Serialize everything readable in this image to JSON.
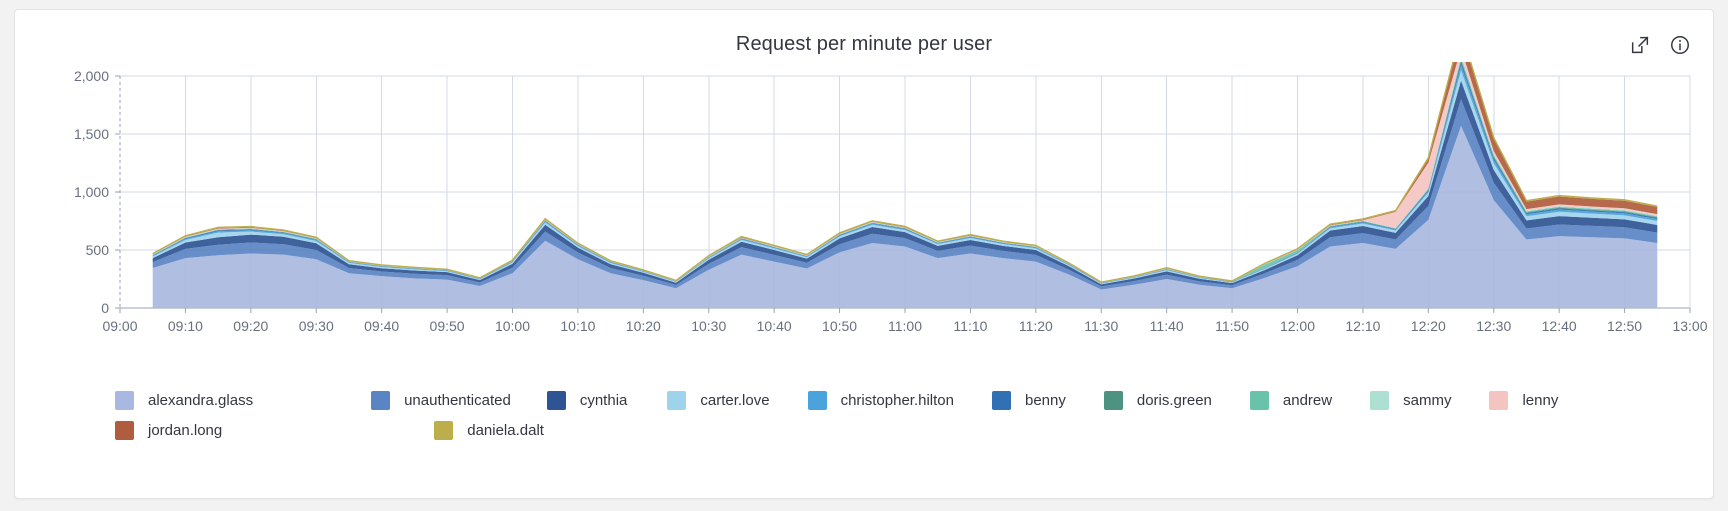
{
  "panel": {
    "title": "Request per minute per user",
    "actions": [
      {
        "name": "open-in-new-icon",
        "label": "Open in new window"
      },
      {
        "name": "info-icon",
        "label": "Panel information"
      }
    ]
  },
  "legend": [
    {
      "label": "alexandra.glass",
      "color": "#a9b8e0"
    },
    {
      "label": "unauthenticated",
      "color": "#5b84c4"
    },
    {
      "label": "cynthia",
      "color": "#2f5494"
    },
    {
      "label": "carter.love",
      "color": "#9fd3ec"
    },
    {
      "label": "christopher.hilton",
      "color": "#4aa3db"
    },
    {
      "label": "benny",
      "color": "#3070b3"
    },
    {
      "label": "doris.green",
      "color": "#4e9281"
    },
    {
      "label": "andrew",
      "color": "#69c3ab"
    },
    {
      "label": "sammy",
      "color": "#aee0d2"
    },
    {
      "label": "lenny",
      "color": "#f4c4c0"
    },
    {
      "label": "jordan.long",
      "color": "#b05c3e"
    },
    {
      "label": "daniela.dalt",
      "color": "#bdae4c"
    }
  ],
  "chart_data": {
    "type": "area",
    "stacked": true,
    "title": "Request per minute per user",
    "xlabel": "",
    "ylabel": "",
    "grid": true,
    "legend_position": "bottom",
    "ylim": [
      0,
      2000
    ],
    "yticks": [
      0,
      500,
      1000,
      1500,
      2000
    ],
    "ytick_labels": [
      "0",
      "500",
      "1,000",
      "1,500",
      "2,000"
    ],
    "xticks": [
      "09:00",
      "09:10",
      "09:20",
      "09:30",
      "09:40",
      "09:50",
      "10:00",
      "10:10",
      "10:20",
      "10:30",
      "10:40",
      "10:50",
      "11:00",
      "11:10",
      "11:20",
      "11:30",
      "11:40",
      "11:50",
      "12:00",
      "12:10",
      "12:20",
      "12:30",
      "12:40",
      "12:50",
      "13:00"
    ],
    "x": [
      "09:05",
      "09:10",
      "09:15",
      "09:20",
      "09:25",
      "09:30",
      "09:35",
      "09:40",
      "09:45",
      "09:50",
      "09:55",
      "10:00",
      "10:05",
      "10:10",
      "10:15",
      "10:20",
      "10:25",
      "10:30",
      "10:35",
      "10:40",
      "10:45",
      "10:50",
      "10:55",
      "11:00",
      "11:05",
      "11:10",
      "11:15",
      "11:20",
      "11:25",
      "11:30",
      "11:35",
      "11:40",
      "11:45",
      "11:50",
      "11:55",
      "12:00",
      "12:05",
      "12:10",
      "12:15",
      "12:20",
      "12:25",
      "12:30",
      "12:35",
      "12:40",
      "12:45",
      "12:50",
      "12:55"
    ],
    "series": [
      {
        "name": "alexandra.glass",
        "color": "#a9b8e0",
        "values": [
          345,
          430,
          455,
          470,
          460,
          420,
          300,
          275,
          255,
          245,
          190,
          300,
          580,
          420,
          300,
          240,
          170,
          330,
          460,
          400,
          340,
          480,
          560,
          530,
          430,
          470,
          430,
          400,
          290,
          160,
          200,
          250,
          200,
          170,
          260,
          360,
          530,
          560,
          510,
          760,
          1570,
          930,
          590,
          620,
          610,
          600,
          560
        ]
      },
      {
        "name": "unauthenticated",
        "color": "#5b84c4",
        "values": [
          50,
          80,
          90,
          95,
          90,
          80,
          45,
          40,
          40,
          38,
          30,
          48,
          80,
          58,
          45,
          38,
          28,
          50,
          65,
          58,
          50,
          70,
          80,
          72,
          62,
          68,
          62,
          58,
          42,
          26,
          32,
          38,
          30,
          26,
          40,
          55,
          80,
          85,
          80,
          120,
          230,
          150,
          95,
          100,
          98,
          96,
          90
        ]
      },
      {
        "name": "cynthia",
        "color": "#2f5494",
        "values": [
          35,
          55,
          65,
          68,
          64,
          58,
          32,
          28,
          28,
          26,
          20,
          34,
          58,
          42,
          32,
          26,
          20,
          36,
          46,
          42,
          36,
          50,
          58,
          52,
          44,
          48,
          44,
          42,
          30,
          18,
          22,
          28,
          22,
          18,
          28,
          40,
          58,
          62,
          58,
          85,
          160,
          110,
          70,
          72,
          70,
          68,
          66
        ]
      },
      {
        "name": "carter.love",
        "color": "#9fd3ec",
        "values": [
          14,
          22,
          40,
          26,
          22,
          20,
          12,
          10,
          10,
          9,
          7,
          12,
          20,
          14,
          11,
          9,
          7,
          12,
          16,
          14,
          12,
          17,
          20,
          18,
          15,
          17,
          15,
          14,
          10,
          6,
          8,
          10,
          8,
          6,
          10,
          14,
          20,
          22,
          20,
          30,
          90,
          58,
          36,
          38,
          36,
          35,
          34
        ]
      },
      {
        "name": "christopher.hilton",
        "color": "#4aa3db",
        "values": [
          6,
          9,
          12,
          11,
          9,
          8,
          5,
          4,
          4,
          4,
          3,
          5,
          8,
          6,
          5,
          4,
          3,
          5,
          7,
          6,
          5,
          7,
          8,
          7,
          6,
          7,
          6,
          6,
          4,
          3,
          3,
          4,
          3,
          3,
          4,
          6,
          8,
          9,
          8,
          14,
          45,
          28,
          17,
          18,
          17,
          17,
          16
        ]
      },
      {
        "name": "benny",
        "color": "#3070b3",
        "values": [
          4,
          6,
          8,
          7,
          6,
          5,
          3,
          3,
          3,
          2,
          2,
          3,
          5,
          4,
          3,
          2,
          2,
          3,
          4,
          4,
          3,
          5,
          5,
          5,
          4,
          4,
          4,
          4,
          3,
          2,
          2,
          3,
          2,
          2,
          3,
          4,
          5,
          6,
          5,
          9,
          30,
          19,
          11,
          12,
          11,
          11,
          11
        ]
      },
      {
        "name": "doris.green",
        "color": "#4e9281",
        "values": [
          2,
          3,
          4,
          4,
          3,
          3,
          2,
          2,
          2,
          1,
          1,
          2,
          3,
          2,
          2,
          1,
          1,
          2,
          2,
          2,
          2,
          3,
          3,
          3,
          2,
          3,
          2,
          2,
          2,
          1,
          1,
          2,
          1,
          1,
          2,
          2,
          3,
          3,
          3,
          5,
          16,
          10,
          6,
          6,
          6,
          6,
          6
        ]
      },
      {
        "name": "andrew",
        "color": "#69c3ab",
        "values": [
          2,
          3,
          4,
          4,
          3,
          3,
          2,
          2,
          2,
          1,
          1,
          2,
          3,
          2,
          2,
          1,
          1,
          2,
          3,
          2,
          2,
          3,
          3,
          3,
          2,
          3,
          2,
          2,
          2,
          1,
          1,
          2,
          1,
          1,
          28,
          18,
          4,
          4,
          3,
          6,
          22,
          14,
          8,
          8,
          8,
          8,
          8
        ]
      },
      {
        "name": "sammy",
        "color": "#aee0d2",
        "values": [
          2,
          3,
          3,
          3,
          3,
          2,
          1,
          1,
          1,
          1,
          1,
          1,
          2,
          2,
          1,
          1,
          1,
          2,
          2,
          2,
          2,
          2,
          3,
          2,
          2,
          2,
          2,
          2,
          1,
          1,
          1,
          2,
          1,
          1,
          2,
          2,
          2,
          3,
          2,
          4,
          14,
          9,
          5,
          5,
          5,
          5,
          5
        ]
      },
      {
        "name": "lenny",
        "color": "#f4c4c0",
        "values": [
          2,
          3,
          3,
          3,
          3,
          2,
          1,
          1,
          1,
          1,
          1,
          1,
          2,
          2,
          1,
          1,
          1,
          2,
          2,
          2,
          2,
          2,
          2,
          2,
          2,
          2,
          2,
          2,
          1,
          1,
          1,
          2,
          1,
          1,
          2,
          2,
          2,
          3,
          140,
          220,
          60,
          24,
          14,
          14,
          14,
          14,
          13
        ]
      },
      {
        "name": "jordan.long",
        "color": "#b05c3e",
        "values": [
          3,
          4,
          5,
          5,
          4,
          4,
          2,
          2,
          2,
          2,
          2,
          2,
          4,
          3,
          2,
          2,
          2,
          3,
          4,
          3,
          3,
          4,
          4,
          4,
          3,
          4,
          3,
          3,
          2,
          2,
          2,
          3,
          2,
          2,
          3,
          4,
          5,
          5,
          5,
          32,
          140,
          105,
          65,
          68,
          66,
          65,
          62
        ]
      },
      {
        "name": "daniela.dalt",
        "color": "#bdae4c",
        "values": [
          4,
          5,
          6,
          6,
          5,
          5,
          3,
          3,
          3,
          3,
          2,
          3,
          5,
          4,
          3,
          3,
          2,
          4,
          5,
          4,
          4,
          5,
          5,
          5,
          4,
          5,
          4,
          4,
          3,
          2,
          3,
          3,
          3,
          2,
          3,
          4,
          6,
          6,
          6,
          9,
          14,
          11,
          8,
          8,
          8,
          8,
          7
        ]
      }
    ]
  }
}
